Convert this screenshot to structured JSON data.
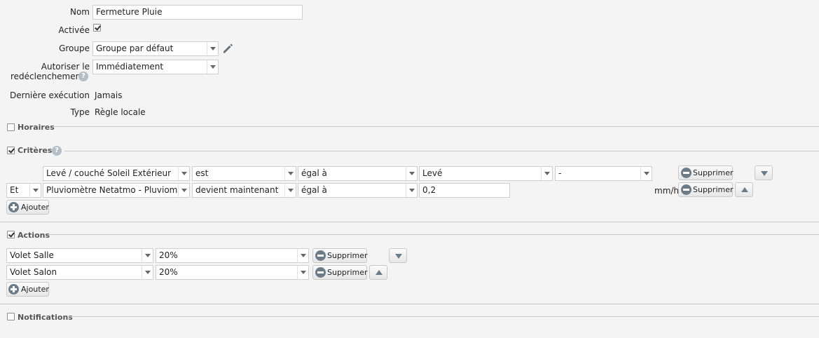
{
  "form": {
    "name_label": "Nom",
    "name_value": "Fermeture Pluie",
    "enabled_label": "Activée",
    "enabled_checked": true,
    "group_label": "Groupe",
    "group_value": "Groupe par défaut",
    "retrigger_label_line1": "Autoriser le",
    "retrigger_label_line2": "redéclenchement",
    "retrigger_value": "Immédiatement",
    "last_run_label": "Dernière exécution",
    "last_run_value": "Jamais",
    "type_label": "Type",
    "type_value": "Règle locale"
  },
  "sections": {
    "horaires": "Horaires",
    "criteres": "Critères",
    "actions": "Actions",
    "notifications": "Notifications"
  },
  "criteria": {
    "rows": [
      {
        "conjunction": "",
        "device": "Levé / couché Soleil Extérieur",
        "operator": "est",
        "comparator": "égal à",
        "value": "Levé",
        "extra": "-",
        "unit": "",
        "delete_label": "Supprimer"
      },
      {
        "conjunction": "Et",
        "device": "Pluviomètre Netatmo - Pluviometrie",
        "operator": "devient maintenant",
        "comparator": "égal à",
        "value": "0,2",
        "extra": "",
        "unit": "mm/h",
        "delete_label": "Supprimer"
      }
    ],
    "add_label": "Ajouter"
  },
  "actions": {
    "rows": [
      {
        "device": "Volet Salle",
        "value": "20%",
        "delete_label": "Supprimer"
      },
      {
        "device": "Volet Salon",
        "value": "20%",
        "delete_label": "Supprimer"
      }
    ],
    "add_label": "Ajouter"
  },
  "icons": {
    "help": "help-icon",
    "edit": "pencil-icon",
    "remove": "minus-circle-icon",
    "add": "plus-circle-icon",
    "move_down": "arrow-down-icon",
    "move_up": "arrow-up-icon"
  },
  "colors": {
    "background": "#f4f4f4",
    "icon_accent": "#6c7b88",
    "divider": "#c9c9c9"
  }
}
